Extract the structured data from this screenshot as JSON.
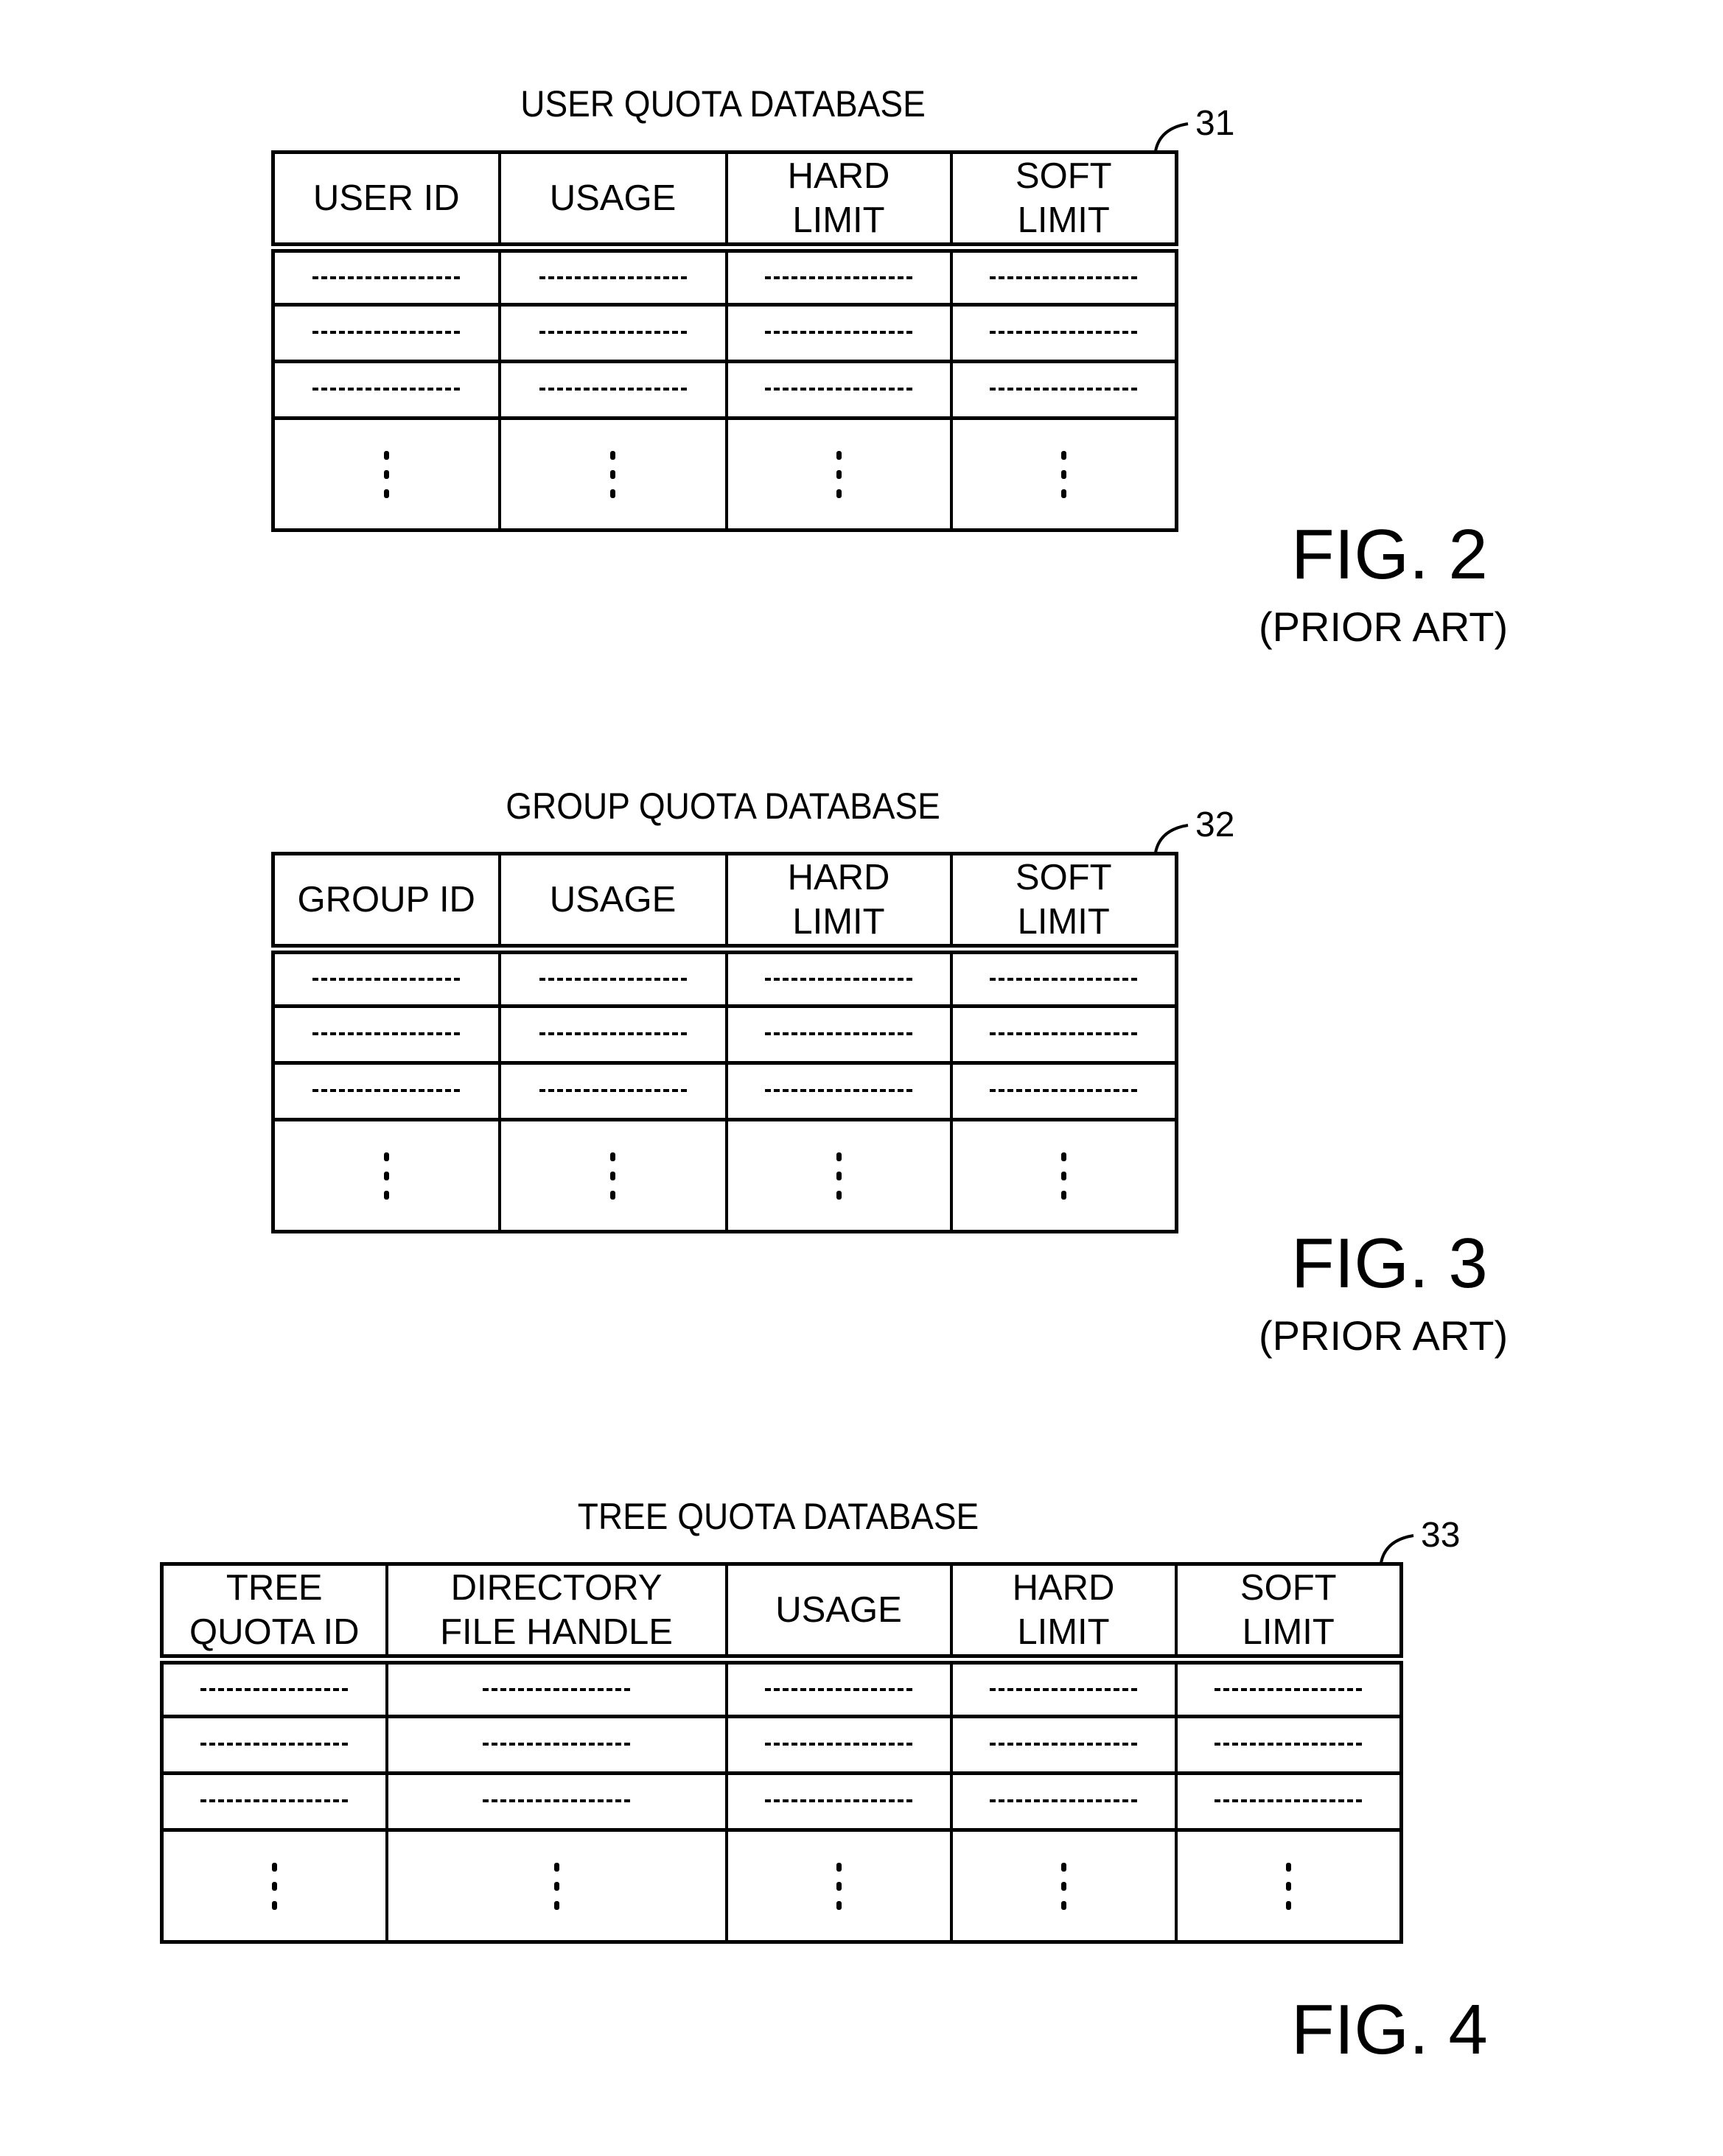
{
  "figures": [
    {
      "id": "fig2",
      "title": "USER QUOTA DATABASE",
      "ref_number": "31",
      "columns": [
        {
          "line1": "USER ID",
          "line2": ""
        },
        {
          "line1": "USAGE",
          "line2": ""
        },
        {
          "line1": "HARD",
          "line2": "LIMIT"
        },
        {
          "line1": "SOFT",
          "line2": "LIMIT"
        }
      ],
      "placeholder_rows": 3,
      "ellipsis_row": true,
      "fig_label": "FIG. 2",
      "fig_note": "(PRIOR ART)"
    },
    {
      "id": "fig3",
      "title": "GROUP QUOTA DATABASE",
      "ref_number": "32",
      "columns": [
        {
          "line1": "GROUP ID",
          "line2": ""
        },
        {
          "line1": "USAGE",
          "line2": ""
        },
        {
          "line1": "HARD",
          "line2": "LIMIT"
        },
        {
          "line1": "SOFT",
          "line2": "LIMIT"
        }
      ],
      "placeholder_rows": 3,
      "ellipsis_row": true,
      "fig_label": "FIG. 3",
      "fig_note": "(PRIOR ART)"
    },
    {
      "id": "fig4",
      "title": "TREE QUOTA DATABASE",
      "ref_number": "33",
      "columns": [
        {
          "line1": "TREE",
          "line2": "QUOTA ID"
        },
        {
          "line1": "DIRECTORY",
          "line2": "FILE HANDLE"
        },
        {
          "line1": "USAGE",
          "line2": ""
        },
        {
          "line1": "HARD",
          "line2": "LIMIT"
        },
        {
          "line1": "SOFT",
          "line2": "LIMIT"
        }
      ],
      "placeholder_rows": 3,
      "ellipsis_row": true,
      "fig_label": "FIG. 4",
      "fig_note": ""
    }
  ]
}
